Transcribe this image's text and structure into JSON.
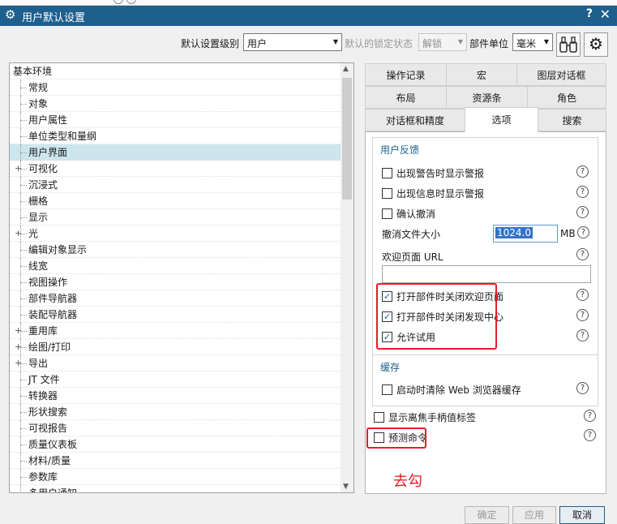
{
  "window": {
    "title": "用户默认设置",
    "help": "?",
    "close": "✕"
  },
  "toolbar": {
    "level_label": "默认设置级别",
    "level_value": "用户",
    "lock_label": "默认的锁定状态",
    "lock_value": "解锁",
    "unit_label": "部件单位",
    "unit_value": "毫米",
    "binoculars_icon": "binoculars-icon",
    "settings_icon": "gear-icon"
  },
  "tree": {
    "items": [
      {
        "label": "基本环境",
        "root": true
      },
      {
        "label": "常规"
      },
      {
        "label": "对象"
      },
      {
        "label": "用户属性"
      },
      {
        "label": "单位类型和量纲"
      },
      {
        "label": "用户界面",
        "selected": true
      },
      {
        "label": "可视化",
        "expand": "+"
      },
      {
        "label": "沉浸式"
      },
      {
        "label": "栅格"
      },
      {
        "label": "显示"
      },
      {
        "label": "光",
        "expand": "+"
      },
      {
        "label": "编辑对象显示"
      },
      {
        "label": "线宽"
      },
      {
        "label": "视图操作"
      },
      {
        "label": "部件导航器"
      },
      {
        "label": "装配导航器"
      },
      {
        "label": "重用库",
        "expand": "+"
      },
      {
        "label": "绘图/打印",
        "expand": "+"
      },
      {
        "label": "导出",
        "expand": "+"
      },
      {
        "label": "JT 文件"
      },
      {
        "label": "转换器"
      },
      {
        "label": "形状搜索"
      },
      {
        "label": "可视报告"
      },
      {
        "label": "质量仪表板"
      },
      {
        "label": "材料/质量"
      },
      {
        "label": "参数库"
      },
      {
        "label": "多用户通知"
      }
    ]
  },
  "tabs": {
    "row1": [
      "操作记录",
      "宏",
      "图层对话框"
    ],
    "row2": [
      "布局",
      "资源条",
      "角色"
    ],
    "row3": [
      "对话框和精度",
      "选项",
      "搜索"
    ],
    "active": "选项"
  },
  "options": {
    "feedback_title": "用户反馈",
    "warn_alert": {
      "label": "出现警告时显示警报",
      "checked": false
    },
    "info_alert": {
      "label": "出现信息时显示警报",
      "checked": false
    },
    "confirm_undo": {
      "label": "确认撤消",
      "checked": false
    },
    "undo_size_label": "撤消文件大小",
    "undo_size_value": "1024.0",
    "undo_size_unit": "MB",
    "welcome_url_label": "欢迎页面 URL",
    "welcome_url_value": "",
    "close_welcome": {
      "label": "打开部件时关闭欢迎页面",
      "checked": true
    },
    "close_discovery": {
      "label": "打开部件时关闭发现中心",
      "checked": true
    },
    "allow_trial": {
      "label": "允许试用",
      "checked": true
    },
    "cache_title": "缓存",
    "clear_cache": {
      "label": "启动时清除 Web 浏览器缓存",
      "checked": false
    },
    "show_defocus": {
      "label": "显示离焦手柄值标签",
      "checked": false
    },
    "predict_cmd": {
      "label": "预测命令",
      "checked": false
    },
    "help_glyph": "?",
    "check_glyph": "✓"
  },
  "annotation": {
    "text": "去勾",
    "color": "#e0202a"
  },
  "buttons": {
    "ok": "确定",
    "apply": "应用",
    "cancel": "取消"
  },
  "colors": {
    "titlebar": "#1f5f8d",
    "selection": "#cde6ee",
    "accent": "#1f5f8d"
  }
}
